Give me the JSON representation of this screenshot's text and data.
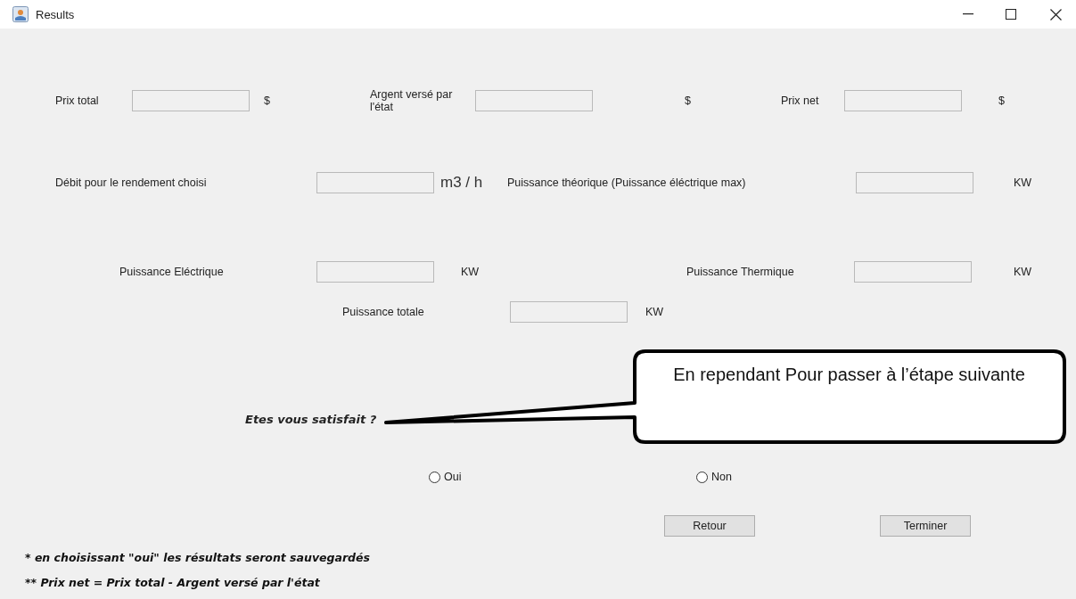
{
  "window": {
    "title": "Results"
  },
  "rows": [
    {
      "items": [
        {
          "kind": "label",
          "text": "Prix total"
        },
        {
          "kind": "field"
        },
        {
          "kind": "unit",
          "text": "$"
        },
        {
          "kind": "label",
          "text": "Argent versé par l'état"
        },
        {
          "kind": "field"
        },
        {
          "kind": "unit",
          "text": "$"
        },
        {
          "kind": "label",
          "text": "Prix net"
        },
        {
          "kind": "field"
        },
        {
          "kind": "unit",
          "text": "$"
        }
      ]
    },
    {
      "items": [
        {
          "kind": "label",
          "text": "Débit pour le rendement choisi"
        },
        {
          "kind": "field"
        },
        {
          "kind": "bigunit",
          "text": "m3 / h"
        },
        {
          "kind": "label",
          "text": "Puissance théorique (Puissance éléctrique max)"
        },
        {
          "kind": "field"
        },
        {
          "kind": "unit",
          "text": "KW"
        }
      ]
    },
    {
      "items": [
        {
          "kind": "label",
          "text": "Puissance Eléctrique"
        },
        {
          "kind": "field"
        },
        {
          "kind": "unit",
          "text": "KW"
        },
        {
          "kind": "label",
          "text": "Puissance Thermique"
        },
        {
          "kind": "field"
        },
        {
          "kind": "unit",
          "text": "KW"
        }
      ]
    },
    {
      "items": [
        {
          "kind": "label",
          "text": "Puissance totale"
        },
        {
          "kind": "field"
        },
        {
          "kind": "unit",
          "text": "KW"
        }
      ]
    }
  ],
  "question": "Etes vous satisfait ?",
  "options": [
    {
      "label": "Oui",
      "selected": false
    },
    {
      "label": "Non",
      "selected": false
    }
  ],
  "buttons": [
    "Retour",
    "Terminer"
  ],
  "notes": [
    "* en choisissant \"oui\"  les résultats seront sauvegardés",
    "** Prix net = Prix total - Argent versé par l'état"
  ],
  "callout": {
    "text": "En rependant Pour passer à l’étape suivante"
  }
}
